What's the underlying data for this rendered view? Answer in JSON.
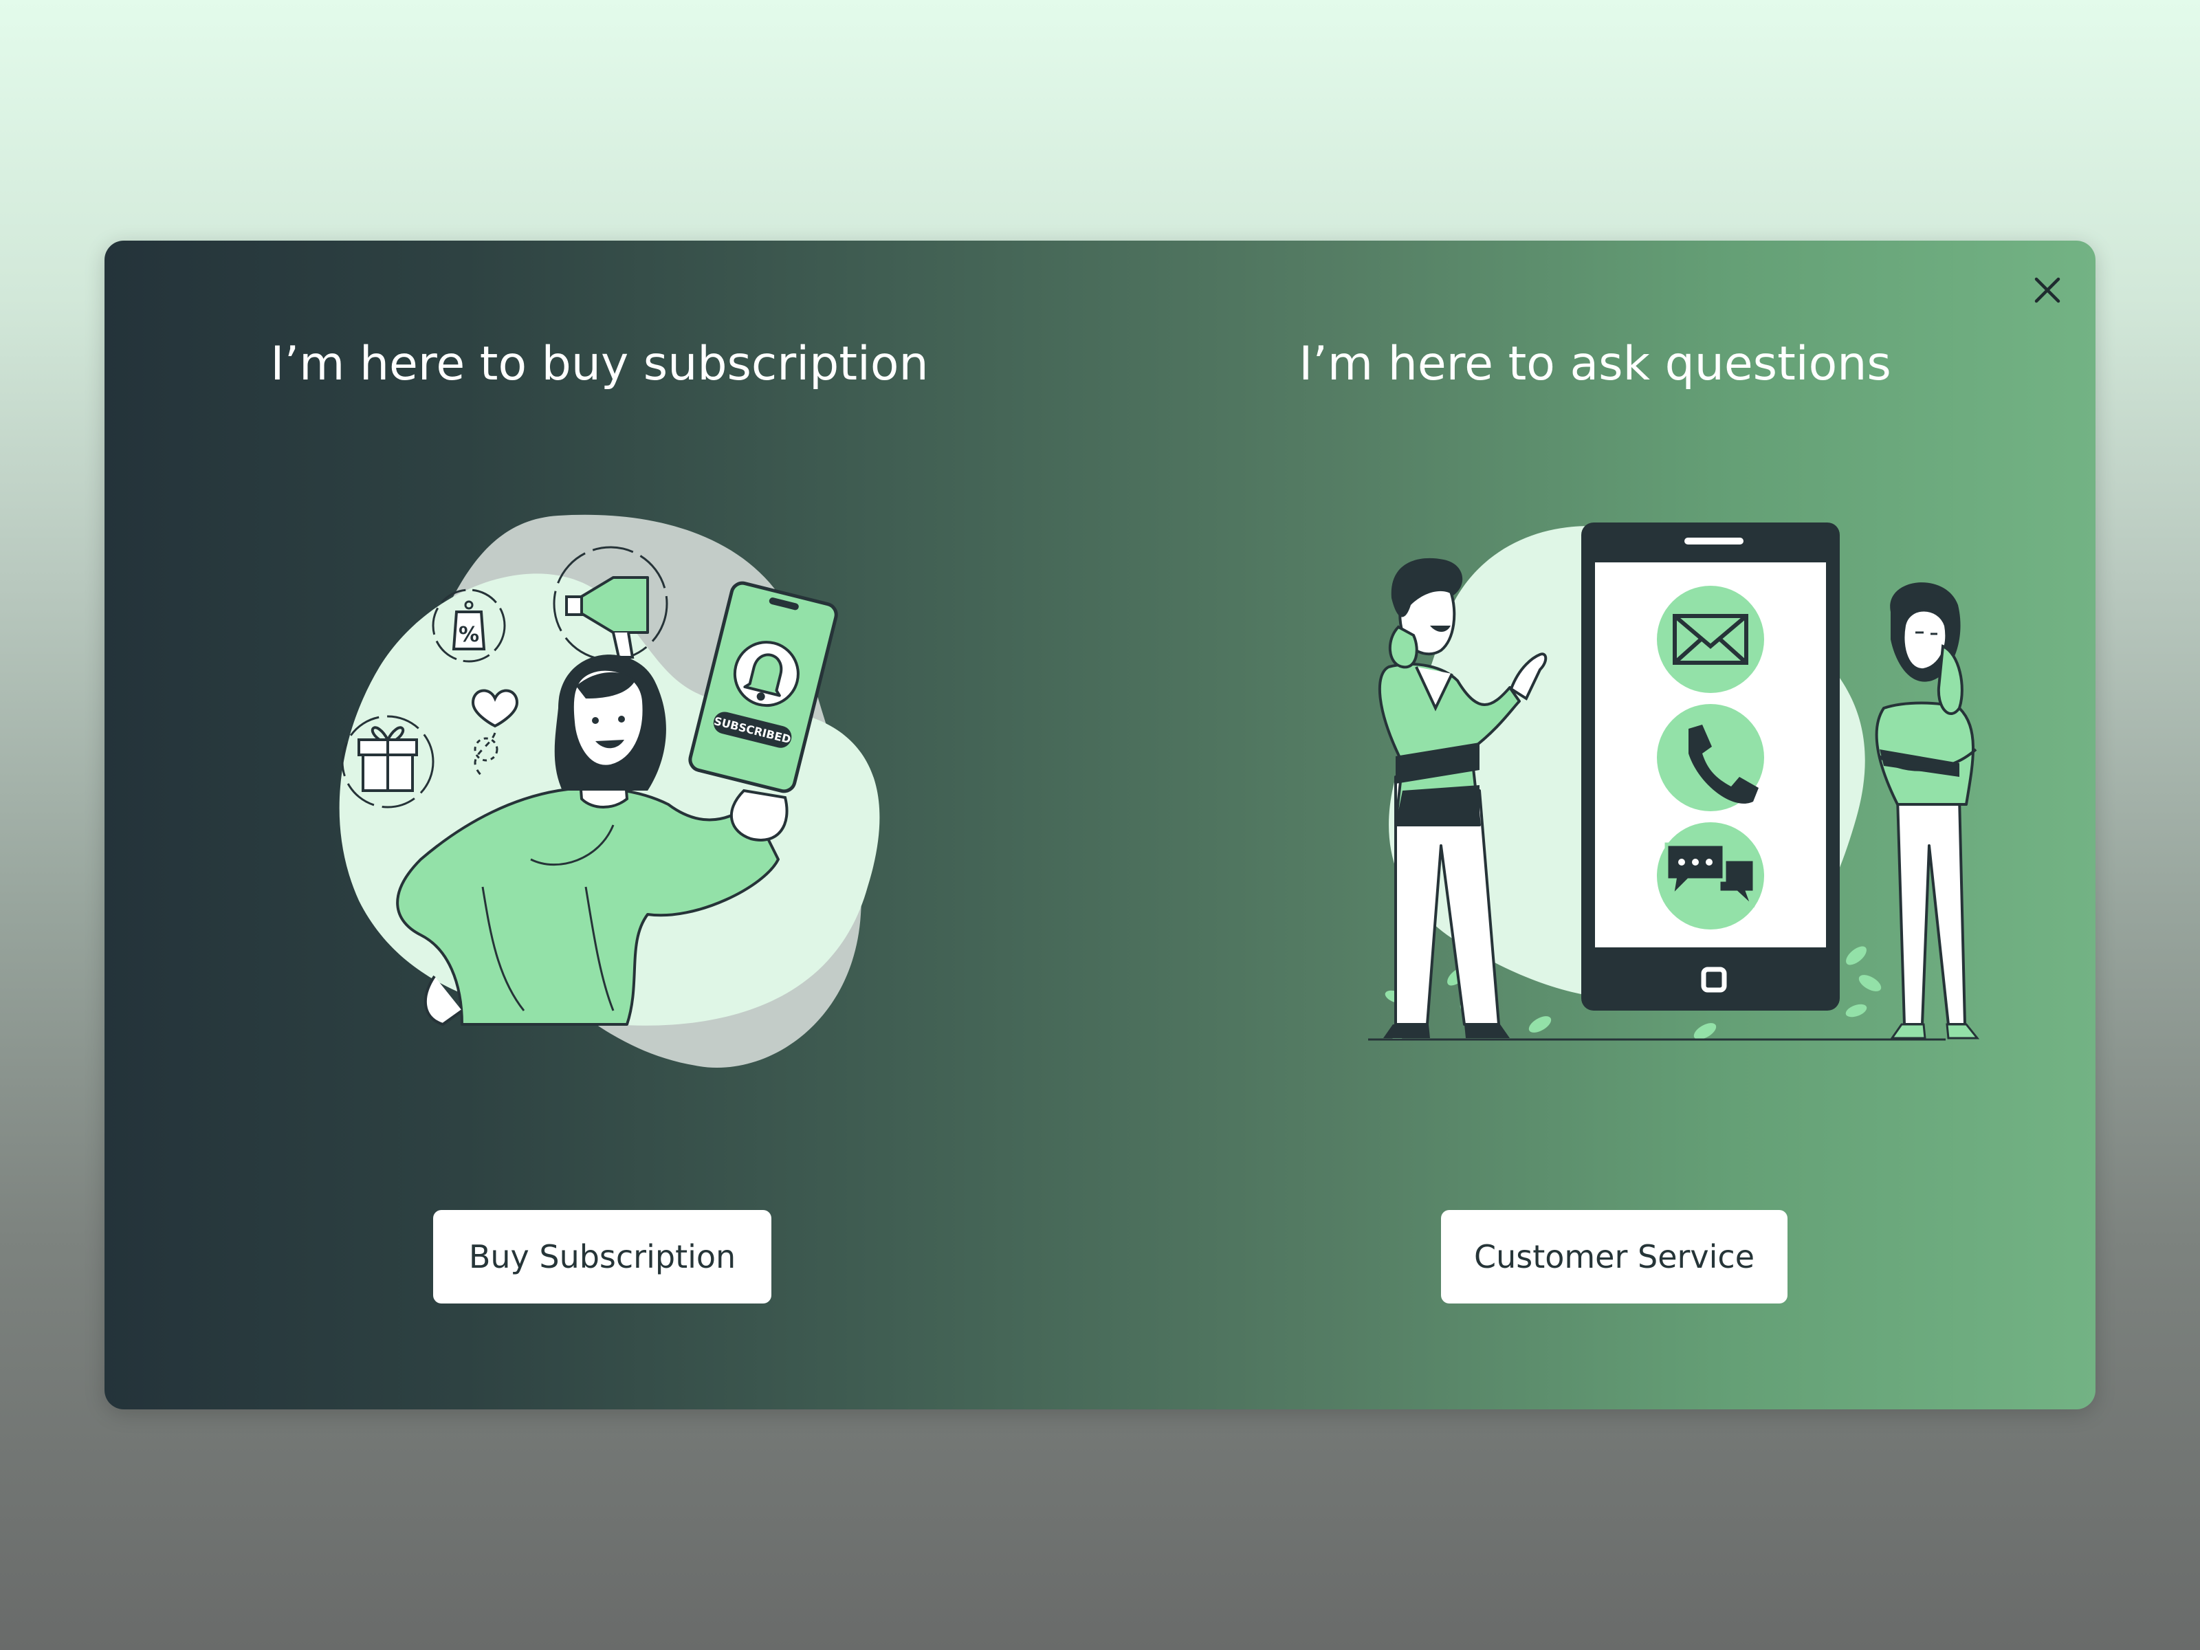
{
  "modal": {
    "close_icon": "close-icon",
    "options": [
      {
        "heading": "I’m here to buy subscription",
        "button_label": "Buy Subscription",
        "illustration": "woman-holding-phone-subscribed"
      },
      {
        "heading": "I’m here to ask questions",
        "button_label": "Customer Service",
        "illustration": "people-with-contact-phone"
      }
    ],
    "phone_badge": "SUBSCRIBED",
    "tag_symbol": "%"
  },
  "colors": {
    "accent_green": "#93e1a8",
    "light_green": "#dff6e6",
    "dark": "#263338",
    "button_bg": "#ffffff"
  }
}
